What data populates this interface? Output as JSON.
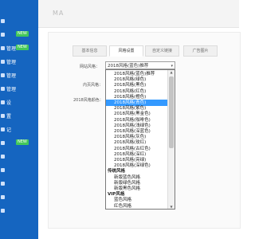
{
  "sidebar": {
    "items": [
      {
        "label": "",
        "badge": ""
      },
      {
        "label": "",
        "badge": "NEW"
      },
      {
        "label": "管理",
        "badge": "NEW"
      },
      {
        "label": "管理",
        "badge": ""
      },
      {
        "label": "管理",
        "badge": ""
      },
      {
        "label": "管理",
        "badge": ""
      },
      {
        "label": "设",
        "badge": ""
      },
      {
        "label": "置",
        "badge": ""
      },
      {
        "label": "记",
        "badge": ""
      },
      {
        "label": "",
        "badge": "NEW"
      },
      {
        "label": "",
        "badge": ""
      },
      {
        "label": "",
        "badge": ""
      },
      {
        "label": "",
        "badge": ""
      },
      {
        "label": "",
        "badge": ""
      },
      {
        "label": "",
        "badge": ""
      }
    ]
  },
  "topbar": {
    "brand": "MA"
  },
  "tabs": [
    {
      "label": "基本信息"
    },
    {
      "label": "风格设置"
    },
    {
      "label": "自定义链接"
    },
    {
      "label": "广告图片"
    }
  ],
  "form": {
    "theme_label": "网站风格：",
    "content_label": "内页风格：",
    "color_label": "2018风格颜色："
  },
  "select": {
    "value": "2018风格(蓝色)推荐"
  },
  "dropdown": {
    "options": [
      {
        "label": "2018风格(蓝色)推荐",
        "type": "option"
      },
      {
        "label": "2018风格(绿色)",
        "type": "option"
      },
      {
        "label": "2018风格(黑色)",
        "type": "option"
      },
      {
        "label": "2018风格(红色)",
        "type": "option"
      },
      {
        "label": "2018风格(橙色)",
        "type": "option"
      },
      {
        "label": "2018风格(青色)",
        "type": "option",
        "selected": true
      },
      {
        "label": "2018风格(紫色)",
        "type": "option"
      },
      {
        "label": "2018风格(黑金色)",
        "type": "option"
      },
      {
        "label": "2018风格(咖啡色)",
        "type": "option"
      },
      {
        "label": "2018风格(浅绿色)",
        "type": "option"
      },
      {
        "label": "2018风格(深蓝色)",
        "type": "option"
      },
      {
        "label": "2018风格(灰色)",
        "type": "option"
      },
      {
        "label": "2018风格(玫红)",
        "type": "option"
      },
      {
        "label": "2018风格(古红色)",
        "type": "option"
      },
      {
        "label": "2018风格(深红)",
        "type": "option"
      },
      {
        "label": "2018风格(亮绿)",
        "type": "option"
      },
      {
        "label": "2018风格(深绿色)",
        "type": "option"
      },
      {
        "label": "传统风格",
        "type": "group"
      },
      {
        "label": "新版蓝色风格",
        "type": "option"
      },
      {
        "label": "新版绿色风格",
        "type": "option"
      },
      {
        "label": "新版黑色风格",
        "type": "option"
      },
      {
        "label": "VIP风格",
        "type": "group"
      },
      {
        "label": "蓝色风格",
        "type": "option"
      },
      {
        "label": "红色风格",
        "type": "option"
      }
    ]
  },
  "colors": {
    "sidebar": "#1565c0",
    "badge": "#43c85a",
    "selection": "#3399ff"
  }
}
